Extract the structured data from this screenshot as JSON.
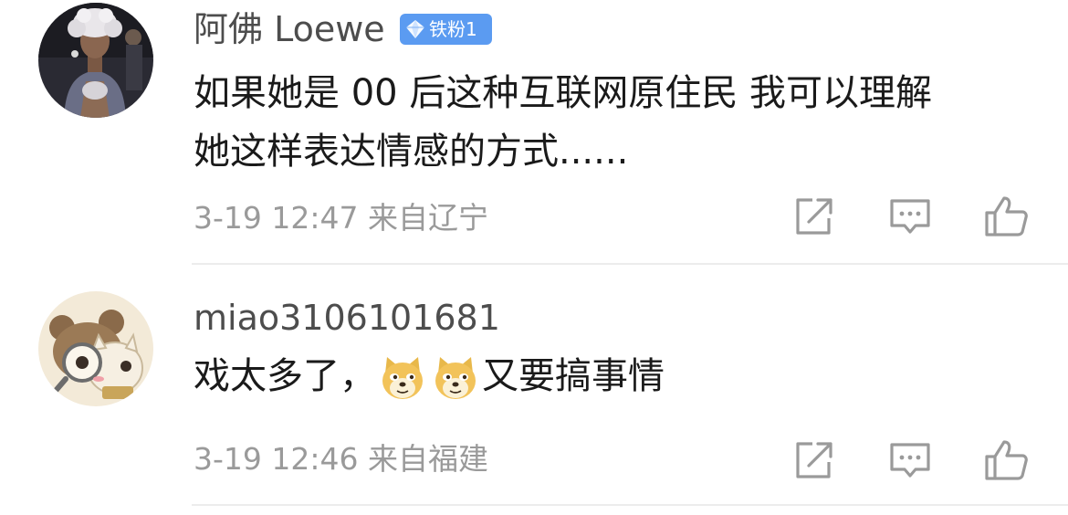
{
  "comments": [
    {
      "username": "阿佛 Loewe",
      "badge": "铁粉1",
      "text_line1": "如果她是 00 后这种互联网原住民 我可以理解",
      "text_line2": "她这样表达情感的方式......",
      "date": "3-19 12:47",
      "location": "来自辽宁",
      "avatar_icon": "person-photo-avatar",
      "action_icons": [
        "share-icon",
        "comment-icon",
        "like-icon"
      ]
    },
    {
      "username": "miao3106101681",
      "text_before": "戏太多了，",
      "text_after": "又要搞事情",
      "emoji_icon": "doge-emoji",
      "date": "3-19 12:46",
      "location": "来自福建",
      "avatar_icon": "cartoon-cat-avatar",
      "action_icons": [
        "share-icon",
        "comment-icon",
        "like-icon"
      ]
    }
  ],
  "colors": {
    "username": "#4d4d4d",
    "text": "#1a1a1a",
    "meta": "#9a9a9a",
    "badge": "#5b9bf1",
    "divider": "#ececec",
    "icon": "#9a9a9a"
  }
}
